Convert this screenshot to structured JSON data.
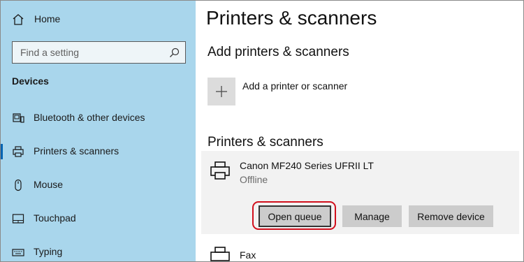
{
  "sidebar": {
    "home_label": "Home",
    "search_placeholder": "Find a setting",
    "section_title": "Devices",
    "items": [
      {
        "label": "Bluetooth & other devices",
        "icon": "bluetooth-devices-icon"
      },
      {
        "label": "Printers & scanners",
        "icon": "printer-icon",
        "active": true
      },
      {
        "label": "Mouse",
        "icon": "mouse-icon"
      },
      {
        "label": "Touchpad",
        "icon": "touchpad-icon"
      },
      {
        "label": "Typing",
        "icon": "keyboard-icon"
      }
    ]
  },
  "main": {
    "page_title": "Printers & scanners",
    "add_heading": "Add printers & scanners",
    "add_label": "Add a printer or scanner",
    "list_heading": "Printers & scanners",
    "printers": [
      {
        "name": "Canon MF240 Series UFRII LT",
        "status": "Offline",
        "buttons": {
          "open_queue": "Open queue",
          "manage": "Manage",
          "remove": "Remove device"
        }
      },
      {
        "name": "Fax"
      }
    ]
  },
  "colors": {
    "sidebar_bg": "#a9d6ec",
    "accent": "#0063b1",
    "highlight_ring": "#d1101d",
    "button_bg": "#cccccc",
    "panel_bg": "#f2f2f2"
  }
}
